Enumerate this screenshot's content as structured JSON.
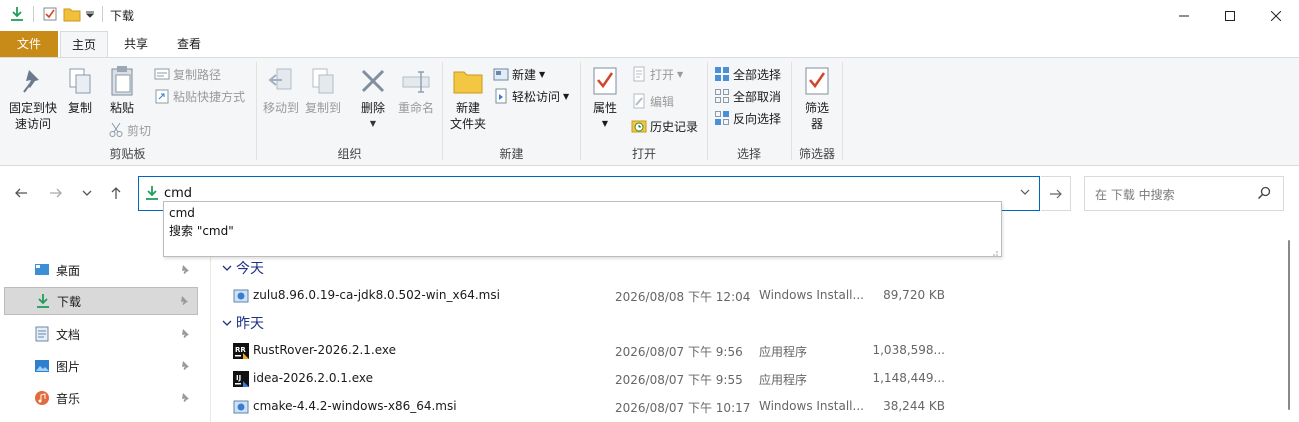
{
  "window": {
    "title": "下载",
    "minimize_icon": "minimize-icon",
    "maximize_icon": "maximize-icon",
    "close_icon": "close-icon"
  },
  "ribbon_tabs": {
    "file": "文件",
    "home": "主页",
    "share": "共享",
    "view": "查看"
  },
  "ribbon": {
    "clipboard": {
      "label": "剪贴板",
      "pin_quick_access": "固定到快\n速访问",
      "copy": "复制",
      "paste": "粘贴",
      "copy_path": "复制路径",
      "paste_shortcut": "粘贴快捷方式",
      "cut": "剪切"
    },
    "organize": {
      "label": "组织",
      "move_to": "移动到",
      "copy_to": "复制到",
      "delete": "删除",
      "rename": "重命名"
    },
    "new": {
      "label": "新建",
      "new_folder": "新建\n文件夹",
      "new_item": "新建",
      "easy_access": "轻松访问"
    },
    "open": {
      "label": "打开",
      "properties": "属性",
      "open": "打开",
      "edit": "编辑",
      "history": "历史记录"
    },
    "select": {
      "label": "选择",
      "select_all": "全部选择",
      "select_none": "全部取消",
      "invert": "反向选择"
    },
    "filter": {
      "label": "筛选器",
      "filter_btn": "筛选\n器"
    }
  },
  "address": {
    "value": "cmd",
    "search_placeholder": "在 下载 中搜索"
  },
  "suggestions": [
    "cmd",
    "搜索 \"cmd\""
  ],
  "nav_pane": [
    {
      "label": "桌面",
      "icon": "desktop-icon",
      "selected": false
    },
    {
      "label": "下载",
      "icon": "download-icon",
      "selected": true
    },
    {
      "label": "文档",
      "icon": "document-icon",
      "selected": false
    },
    {
      "label": "图片",
      "icon": "pictures-icon",
      "selected": false
    },
    {
      "label": "音乐",
      "icon": "music-icon",
      "selected": false
    }
  ],
  "groups": [
    {
      "label": "今天",
      "files": [
        {
          "name": "zulu8.96.0.19-ca-jdk8.0.502-win_x64.msi",
          "date": "2026/08/08 下午 12:04",
          "type": "Windows Install...",
          "size": "89,720 KB",
          "icon": "msi-icon"
        }
      ]
    },
    {
      "label": "昨天",
      "files": [
        {
          "name": "RustRover-2026.2.1.exe",
          "date": "2026/08/07 下午 9:56",
          "type": "应用程序",
          "size": "1,038,598...",
          "icon": "rustrover-icon"
        },
        {
          "name": "idea-2026.2.0.1.exe",
          "date": "2026/08/07 下午 9:55",
          "type": "应用程序",
          "size": "1,148,449...",
          "icon": "idea-icon"
        },
        {
          "name": "cmake-4.4.2-windows-x86_64.msi",
          "date": "2026/08/07 下午 10:17",
          "type": "Windows Install...",
          "size": "38,244 KB",
          "icon": "msi-icon"
        }
      ]
    }
  ],
  "colors": {
    "file_tab": "#c98b17",
    "accent": "#0067c0",
    "group_header": "#1e3287",
    "download_green": "#1f9e5b"
  }
}
